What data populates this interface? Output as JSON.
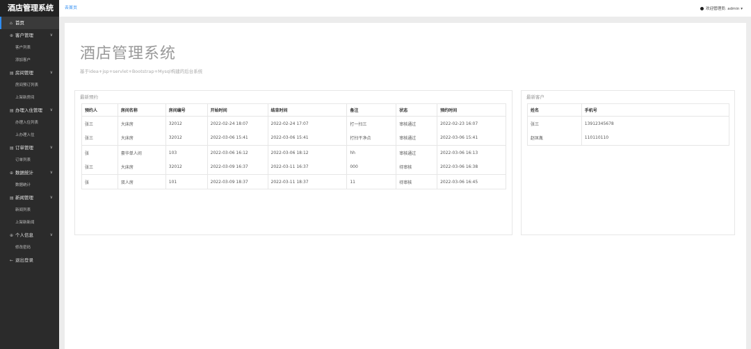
{
  "sidebar": {
    "brand": "酒店管理系统",
    "items": [
      {
        "type": "item",
        "label": "首页",
        "icon": "home-icon",
        "glyph": "⌂",
        "active": true
      },
      {
        "type": "section",
        "label": "客户管理",
        "icon": "users-icon",
        "glyph": "⊕"
      },
      {
        "type": "sub",
        "label": "客户列表"
      },
      {
        "type": "sub",
        "label": "添加客户"
      },
      {
        "type": "section",
        "label": "房间管理",
        "icon": "room-icon",
        "glyph": "▤"
      },
      {
        "type": "sub",
        "label": "房间预订列表"
      },
      {
        "type": "sub",
        "label": "上架新房间"
      },
      {
        "type": "section",
        "label": "办理入住管理",
        "icon": "checkin-icon",
        "glyph": "▤"
      },
      {
        "type": "sub",
        "label": "办理入住列表"
      },
      {
        "type": "sub",
        "label": "上办理入住"
      },
      {
        "type": "section",
        "label": "订单管理",
        "icon": "order-icon",
        "glyph": "▤"
      },
      {
        "type": "sub",
        "label": "订单列表"
      },
      {
        "type": "section",
        "label": "数据统计",
        "icon": "stats-icon",
        "glyph": "⊕"
      },
      {
        "type": "sub",
        "label": "数据统计"
      },
      {
        "type": "section",
        "label": "新闻管理",
        "icon": "news-icon",
        "glyph": "▤"
      },
      {
        "type": "sub",
        "label": "新闻列表"
      },
      {
        "type": "sub",
        "label": "上架新新闻"
      },
      {
        "type": "section",
        "label": "个人信息",
        "icon": "profile-icon",
        "glyph": "⊕"
      },
      {
        "type": "sub",
        "label": "修改密码"
      },
      {
        "type": "item",
        "label": "退出登录",
        "icon": "logout-icon",
        "glyph": "←"
      }
    ]
  },
  "topbar": {
    "breadcrumb": "去首页",
    "user": "欢迎管理员: admin ▾"
  },
  "hero": {
    "title": "酒店管理系统",
    "subtitle": "基于idea+jsp+servlet+Bootstrap+Mysql构建的后台系统"
  },
  "reservations": {
    "title": "最新预约",
    "headers": [
      "预约人",
      "房间名称",
      "房间编号",
      "开始时间",
      "结束时间",
      "备注",
      "状态",
      "预约时间"
    ],
    "rows": [
      [
        "张三",
        "大床房",
        "32012",
        "2022-02-24 18:07",
        "2022-02-24 17:07",
        "打一扫三",
        "审核通过",
        "2022-02-23 16:07"
      ],
      [
        "张三",
        "大床房",
        "32012",
        "2022-03-06 15:41",
        "2022-03-06 15:41",
        "打扫干净点",
        "审核通过",
        "2022-03-06 15:41"
      ],
      [
        "张",
        "豪华单人间",
        "103",
        "2022-03-06 16:12",
        "2022-03-06 18:12",
        "hh",
        "审核通过",
        "2022-03-06 16:13"
      ],
      [
        "张三",
        "大床房",
        "32012",
        "2022-03-09 16:37",
        "2022-03-11 16:37",
        "000",
        "待审核",
        "2022-03-06 16:38"
      ],
      [
        "张",
        "双人房",
        "101",
        "2022-03-09 18:37",
        "2022-03-11 18:37",
        "11",
        "待审核",
        "2022-03-06 16:45"
      ]
    ]
  },
  "customers": {
    "title": "最新客户",
    "headers": [
      "姓名",
      "手机号"
    ],
    "rows": [
      [
        "张三",
        "13912345678"
      ],
      [
        "赵匡胤",
        "110110110"
      ]
    ]
  }
}
